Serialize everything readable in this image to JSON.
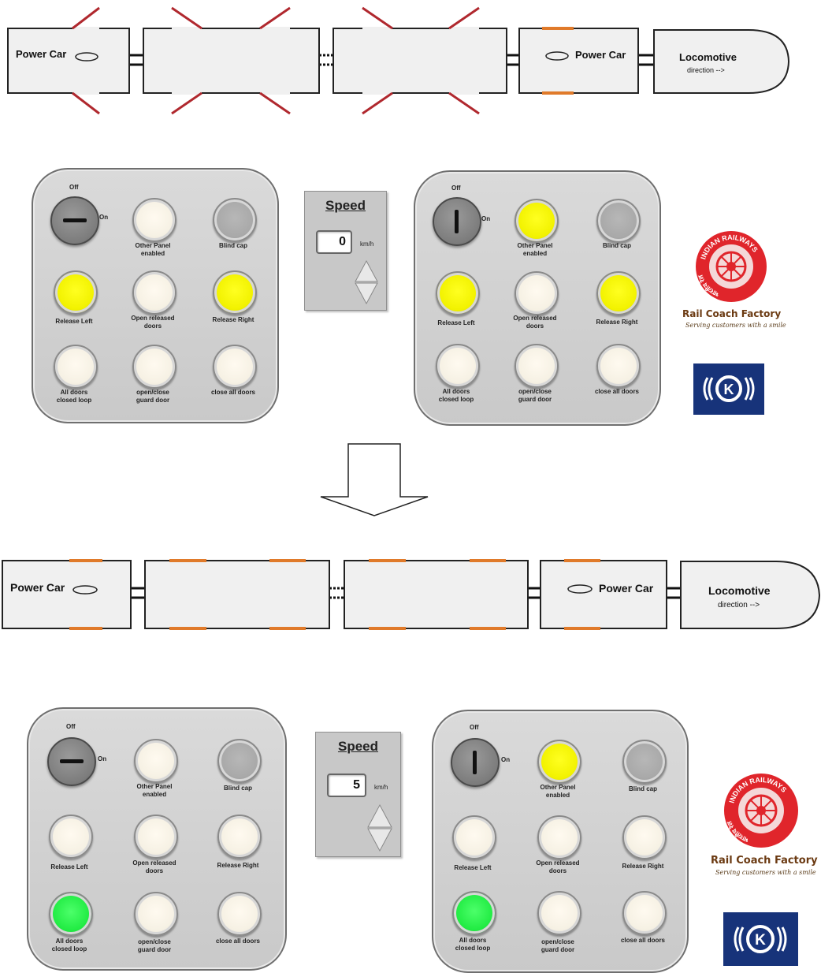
{
  "train": {
    "power_car_label": "Power Car",
    "locomotive_label": "Locomotive",
    "direction_label": "direction -->"
  },
  "panel_left": {
    "off_label": "Off",
    "on_label": "On",
    "buttons": [
      "Other Panel\nenabled",
      "Blind cap",
      "Release Left",
      "Open released\ndoors",
      "Release Right",
      "All doors\nclosed loop",
      "open/close\nguard door",
      "close all doors"
    ]
  },
  "panel_right": {
    "off_label": "Off",
    "on_label": "On",
    "buttons": [
      "Other Panel\nenabled",
      "Blind cap",
      "Release Left",
      "Open released\ndoors",
      "Release Right",
      "All doors\nclosed loop",
      "open/close\nguard door",
      "close all doors"
    ]
  },
  "speed": {
    "title": "Speed",
    "unit": "km/h",
    "before_value": "0",
    "after_value": "5"
  },
  "logos": {
    "rcf_name": "Rail Coach Factory",
    "rcf_tagline": "Serving customers with a smile",
    "railways_ring_text": "INDIAN RAILWAYS",
    "railways_ring_text_hindi": "भारतीय रेल"
  },
  "colors": {
    "door_open_red": "#b0282e",
    "door_closed_orange": "#e07a2a",
    "lamp_yellow": "#f2f200",
    "lamp_green": "#22ec44",
    "lamp_off": "#f6f1e4",
    "lamp_grey": "#a9a9a9"
  },
  "states": {
    "before": {
      "left_lamps": [
        "off",
        "grey",
        "yellow",
        "off",
        "yellow",
        "off",
        "off",
        "off"
      ],
      "right_lamps": [
        "yellow",
        "grey",
        "yellow",
        "off",
        "yellow",
        "off",
        "off",
        "off"
      ]
    },
    "after": {
      "left_lamps": [
        "off",
        "grey",
        "off",
        "off",
        "off",
        "green",
        "off",
        "off"
      ],
      "right_lamps": [
        "yellow",
        "grey",
        "off",
        "off",
        "off",
        "green",
        "off",
        "off"
      ]
    }
  }
}
